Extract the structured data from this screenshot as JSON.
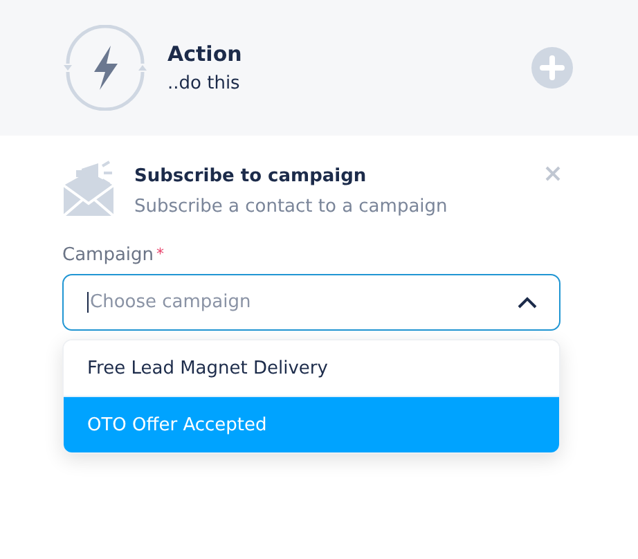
{
  "header": {
    "title": "Action",
    "subtitle": "..do this"
  },
  "step": {
    "title": "Subscribe to campaign",
    "description": "Subscribe a contact to a campaign"
  },
  "field": {
    "label": "Campaign",
    "required": true,
    "required_mark": "*",
    "placeholder": "Choose campaign",
    "expanded": true
  },
  "options": [
    {
      "label": "Free Lead Magnet Delivery",
      "selected": false
    },
    {
      "label": "OTO Offer Accepted",
      "selected": true
    }
  ]
}
